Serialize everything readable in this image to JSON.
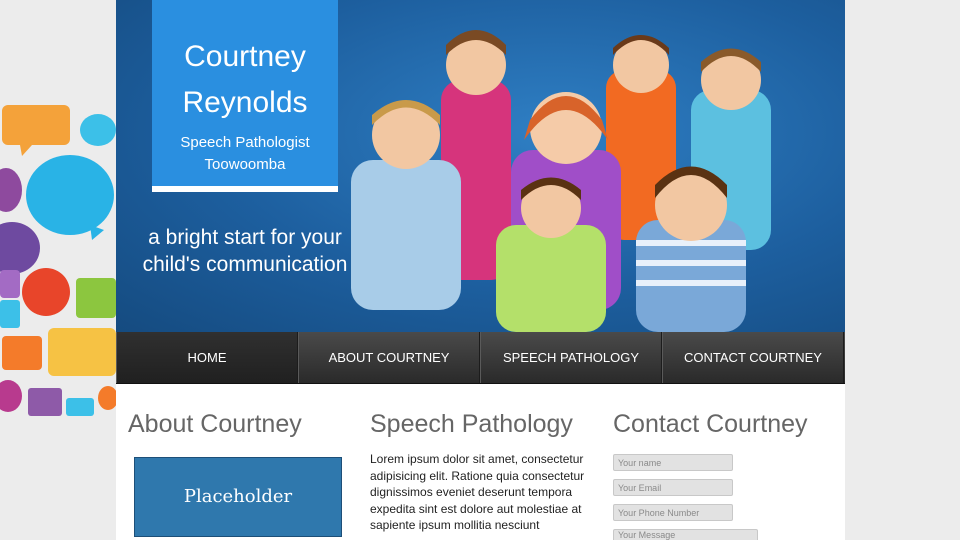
{
  "header": {
    "name": "Courtney Reynolds",
    "name_line1": "Courtney",
    "name_line2": "Reynolds",
    "role": "Speech Pathologist",
    "location": "Toowoomba",
    "tagline": "a bright start for your child's communication"
  },
  "nav": {
    "items": [
      {
        "label": "HOME"
      },
      {
        "label": "ABOUT COURTNEY"
      },
      {
        "label": "SPEECH PATHOLOGY"
      },
      {
        "label": "CONTACT COURTNEY"
      }
    ]
  },
  "about": {
    "title": "About Courtney",
    "placeholder_label": "Placeholder"
  },
  "speech": {
    "title": "Speech Pathology",
    "body": "Lorem ipsum dolor sit amet, consectetur adipisicing elit. Ratione quia consectetur dignissimos eveniet deserunt tempora expedita sint est dolore aut molestiae at sapiente ipsum mollitia nesciunt"
  },
  "contact": {
    "title": "Contact Courtney",
    "name_placeholder": "Your name",
    "email_placeholder": "Your Email",
    "phone_placeholder": "Your Phone Number",
    "message_placeholder": "Your Message"
  },
  "colors": {
    "title_box": "#2a8fe0",
    "hero": "#1d5f9f",
    "nav": "#333333",
    "placeholder_box": "#2f78ad"
  }
}
